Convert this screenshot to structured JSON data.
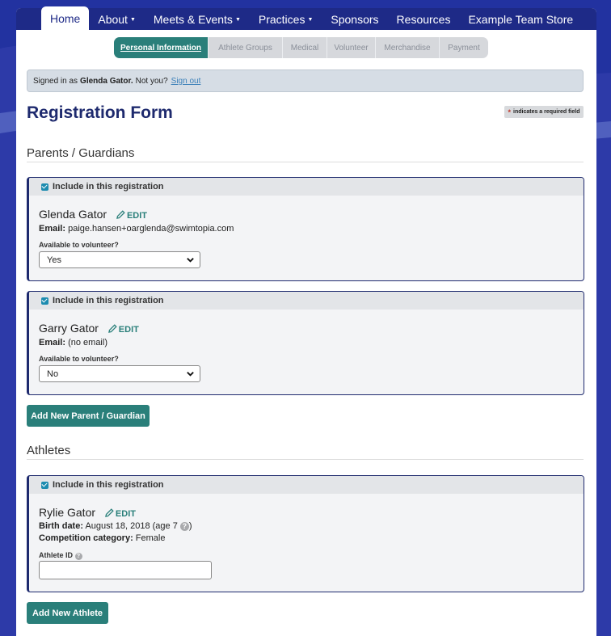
{
  "nav": {
    "items": [
      {
        "label": "Home",
        "active": true,
        "dropdown": false
      },
      {
        "label": "About",
        "active": false,
        "dropdown": true
      },
      {
        "label": "Meets & Events",
        "active": false,
        "dropdown": true
      },
      {
        "label": "Practices",
        "active": false,
        "dropdown": true
      },
      {
        "label": "Sponsors",
        "active": false,
        "dropdown": false
      },
      {
        "label": "Resources",
        "active": false,
        "dropdown": false
      },
      {
        "label": "Example Team Store",
        "active": false,
        "dropdown": false
      }
    ]
  },
  "steps": [
    {
      "label": "Personal Information",
      "active": true
    },
    {
      "label": "Athlete Groups",
      "active": false
    },
    {
      "label": "Medical",
      "active": false
    },
    {
      "label": "Volunteer",
      "active": false
    },
    {
      "label": "Merchandise",
      "active": false
    },
    {
      "label": "Payment",
      "active": false
    }
  ],
  "signin": {
    "prefix": "Signed in as",
    "user": "Glenda Gator.",
    "question": "Not you?",
    "link": "Sign out"
  },
  "page": {
    "title": "Registration Form",
    "required_note": "indicates a required field",
    "required_mark": "*"
  },
  "parents": {
    "heading": "Parents / Guardians",
    "include_label": "Include in this registration",
    "edit_label": "EDIT",
    "email_label": "Email:",
    "volunteer_label": "Available to volunteer?",
    "cards": [
      {
        "name": "Glenda Gator",
        "email": "paige.hansen+oarglenda@swimtopia.com",
        "volunteer": "Yes"
      },
      {
        "name": "Garry Gator",
        "email": "(no email)",
        "volunteer": "No"
      }
    ],
    "add_button": "Add New Parent / Guardian"
  },
  "athletes": {
    "heading": "Athletes",
    "include_label": "Include in this registration",
    "edit_label": "EDIT",
    "card": {
      "name": "Rylie Gator",
      "birth_label": "Birth date:",
      "birth_value": "August 18, 2018 (age 7",
      "birth_close": ")",
      "category_label": "Competition category:",
      "category_value": "Female",
      "athlete_id_label": "Athlete ID",
      "athlete_id_value": ""
    },
    "add_button": "Add New Athlete"
  },
  "colors": {
    "nav_bg": "#1e2a87",
    "accent": "#2a7f7a",
    "title": "#1e2a6e",
    "page_bg": "#2d3aa8"
  }
}
